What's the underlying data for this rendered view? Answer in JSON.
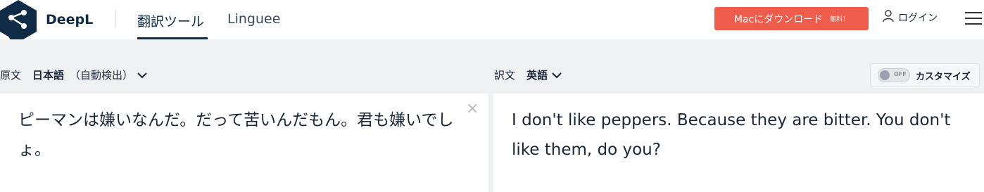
{
  "header": {
    "brand": "DeepL",
    "tabs": [
      {
        "label": "翻訳ツール",
        "active": true
      },
      {
        "label": "Linguee",
        "active": false
      }
    ],
    "mac_button": {
      "label": "Macにダウンロード",
      "badge": "無料！"
    },
    "login_label": "ログイン"
  },
  "source": {
    "label": "原文",
    "language": "日本語",
    "detect_note": "（自動検出）",
    "text": "ピーマンは嫌いなんだ。だって苦いんだもん。君も嫌いでしょ。"
  },
  "target": {
    "label": "訳文",
    "language": "英語",
    "text": "I don't like peppers. Because they are bitter. You don't like them, do you?"
  },
  "customize": {
    "label": "カスタマイズ",
    "toggle_state": "OFF"
  },
  "colors": {
    "accent": "#ef5c4c",
    "brand": "#0f2b46",
    "band": "#f0f1f2"
  },
  "icons": {
    "logo": "deepl-logo-icon",
    "user": "user-icon",
    "menu": "hamburger-menu-icon",
    "chevron": "chevron-down-icon",
    "clear": "close-icon"
  }
}
